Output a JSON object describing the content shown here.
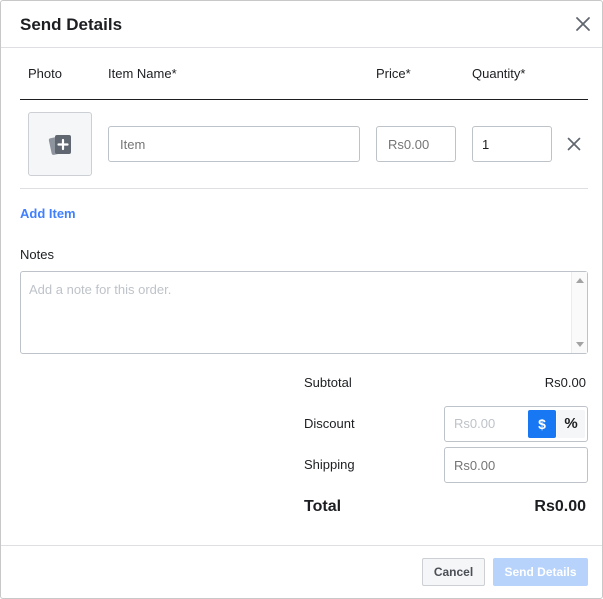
{
  "dialog": {
    "title": "Send Details",
    "close_icon": "close-icon"
  },
  "columns": {
    "photo": "Photo",
    "item_name": "Item Name*",
    "price": "Price*",
    "quantity": "Quantity*"
  },
  "item_row": {
    "photo_icon": "add-photo-icon",
    "item_placeholder": "Item",
    "price_placeholder": "Rs0.00",
    "quantity_value": "1",
    "remove_icon": "close-icon"
  },
  "add_item_label": "Add Item",
  "notes": {
    "label": "Notes",
    "placeholder": "Add a note for this order."
  },
  "summary": {
    "subtotal_label": "Subtotal",
    "subtotal_value": "Rs0.00",
    "discount_label": "Discount",
    "discount_placeholder": "Rs0.00",
    "discount_dollar": "$",
    "discount_percent": "%",
    "shipping_label": "Shipping",
    "shipping_placeholder": "Rs0.00",
    "total_label": "Total",
    "total_value": "Rs0.00"
  },
  "footer": {
    "cancel_label": "Cancel",
    "send_label": "Send Details"
  },
  "colors": {
    "accent": "#1877f2",
    "link": "#4080ff",
    "disabled_button": "#b7d3fb"
  }
}
